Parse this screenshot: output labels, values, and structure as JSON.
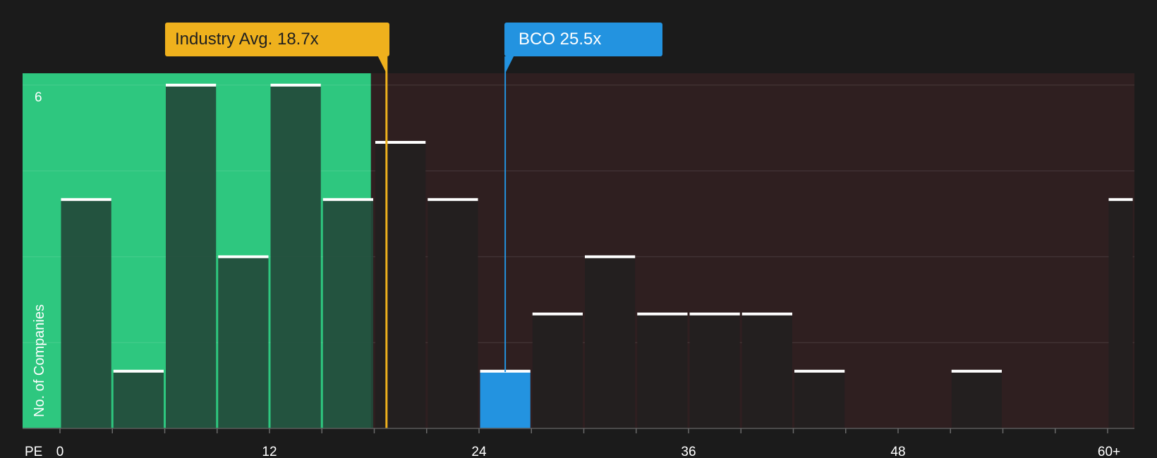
{
  "chart_data": {
    "type": "bar",
    "title": "",
    "xlabel": "PE",
    "ylabel": "No. of Companies",
    "xlim": [
      0,
      60
    ],
    "ylim": [
      0,
      6
    ],
    "x_ticks": [
      "0",
      "12",
      "24",
      "36",
      "48",
      "60+"
    ],
    "y_tick_labels": [
      "6"
    ],
    "bins": [
      {
        "x0": 0,
        "x1": 3,
        "value": 4
      },
      {
        "x0": 3,
        "x1": 6,
        "value": 1
      },
      {
        "x0": 6,
        "x1": 9,
        "value": 6
      },
      {
        "x0": 9,
        "x1": 12,
        "value": 3
      },
      {
        "x0": 12,
        "x1": 15,
        "value": 6
      },
      {
        "x0": 15,
        "x1": 18,
        "value": 4
      },
      {
        "x0": 18,
        "x1": 21,
        "value": 5
      },
      {
        "x0": 21,
        "x1": 24,
        "value": 4
      },
      {
        "x0": 24,
        "x1": 27,
        "value": 1,
        "highlight": true
      },
      {
        "x0": 27,
        "x1": 30,
        "value": 2
      },
      {
        "x0": 30,
        "x1": 33,
        "value": 3
      },
      {
        "x0": 33,
        "x1": 36,
        "value": 2
      },
      {
        "x0": 36,
        "x1": 39,
        "value": 2
      },
      {
        "x0": 39,
        "x1": 42,
        "value": 2
      },
      {
        "x0": 42,
        "x1": 45,
        "value": 1
      },
      {
        "x0": 45,
        "x1": 48,
        "value": 0
      },
      {
        "x0": 48,
        "x1": 51,
        "value": 0
      },
      {
        "x0": 51,
        "x1": 54,
        "value": 1
      },
      {
        "x0": 54,
        "x1": 57,
        "value": 0
      },
      {
        "x0": 57,
        "x1": 60,
        "value": 0
      },
      {
        "x0": 60,
        "x1": 61.5,
        "value": 4
      }
    ],
    "industry_avg": {
      "value": 18.7,
      "label": "Industry Avg. 18.7x"
    },
    "company": {
      "value": 25.5,
      "label": "BCO 25.5x"
    },
    "grid": true,
    "legend": "none",
    "colors": {
      "background": "#1b1b1b",
      "undervalued_region": "#2ec77f",
      "overvalued_region": "#2f1f20",
      "bar_in_green": "#23493a",
      "bar_in_red": "#231f1f",
      "bar_highlight": "#2393e0",
      "industry_line": "#efb11d",
      "company_line": "#2393e0",
      "bar_cap": "#ffffff"
    }
  }
}
